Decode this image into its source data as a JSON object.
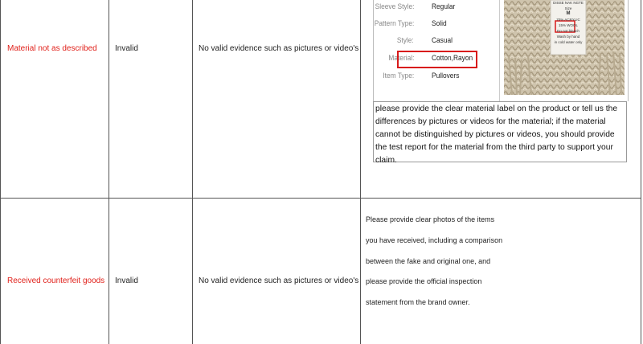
{
  "rows": [
    {
      "reason": "Material not as described",
      "status": "Invalid",
      "evidence": "No valid evidence such as pictures or video's",
      "spec_items": [
        {
          "key": "Sleeve Style:",
          "value": "Regular"
        },
        {
          "key": "Pattern Type:",
          "value": "Solid"
        },
        {
          "key": "Style:",
          "value": "Casual"
        },
        {
          "key": "Material:",
          "value": "Cotton,Rayon"
        },
        {
          "key": "Item Type:",
          "value": "Pullovers"
        }
      ],
      "label_tag_lines": [
        "DISSE NAK NGTE",
        "Size",
        "M",
        "70% ACRYLIC",
        "15% WOOL",
        "Do not bleach",
        "Wash by hand",
        "in cold water only"
      ],
      "guidance": "please provide the clear material label on the product or tell us the differences by pictures or videos for the material; if the material cannot be distinguished by pictures or videos, you should provide the test report for the material from the third party to support your claim."
    },
    {
      "reason": "Received counterfeit goods",
      "status": "Invalid",
      "evidence": "No valid evidence such as pictures or video's",
      "guidance_lines": [
        "Please provide clear photos of the items",
        "you have received, including a comparison",
        "between the fake and original one, and",
        "please provide the official inspection",
        "statement from the brand owner."
      ]
    }
  ],
  "colors": {
    "reason_text": "#e0201a",
    "highlight_box": "#d81b1b",
    "grid": "#555555"
  }
}
